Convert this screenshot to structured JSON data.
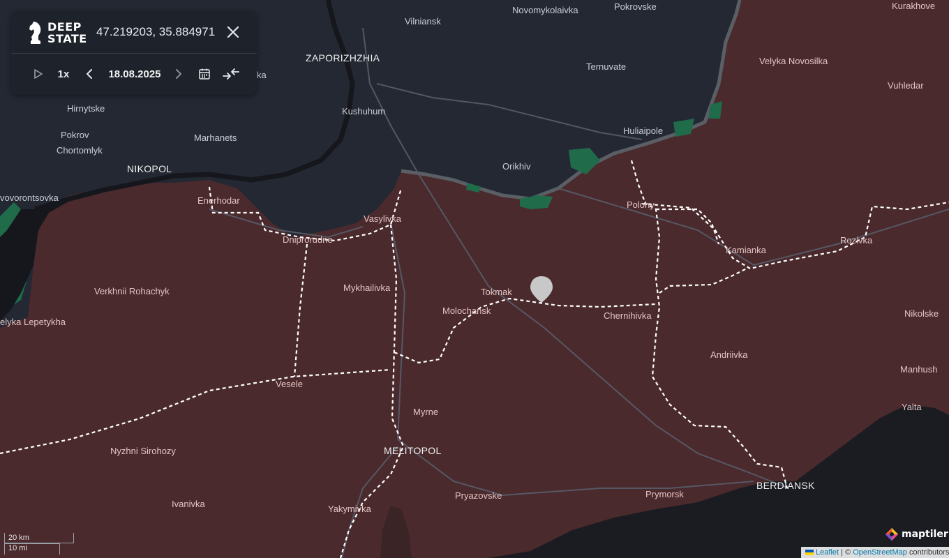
{
  "panel": {
    "logo_line1": "DEEP",
    "logo_line2": "STATE",
    "coordinates": "47.219203, 35.884971",
    "speed": "1x",
    "date": "18.08.2025",
    "icons": [
      "knight-chess-icon",
      "close-icon",
      "play-icon",
      "chevron-left-icon",
      "chevron-right-icon",
      "calendar-icon",
      "compare-arrows-icon"
    ]
  },
  "colors": {
    "free_territory": "#232833",
    "occupied_territory": "#4b2a2d",
    "liberated_territory": "#1f6b4a",
    "sea": "#1a1c21",
    "frontline_buffer": "#5a5f66",
    "railway": "#ffffff"
  },
  "labels": {
    "novomykolaivka": "Novomykolaivka",
    "pokrovske": "Pokrovske",
    "kurakhove": "Kurakhove",
    "vilniansk": "Vilniansk",
    "zaporizhzhia": "ZAPORIZHZHIA",
    "velyka_novosilka": "Velyka Novosilka",
    "ternuvate": "Ternuvate",
    "vuhledar": "Vuhledar",
    "ka": "ka",
    "hirnytske": "Hirnytske",
    "kushuhum": "Kushuhum",
    "huliaipole": "Huliaipole",
    "pokrov": "Pokrov",
    "marhanets": "Marhanets",
    "chortomlyk": "Chortomlyk",
    "orikhiv": "Orikhiv",
    "nikopol": "NIKOPOL",
    "vovorontsovka": "vovorontsovka",
    "enerhodar": "Enerhodar",
    "polohy": "Polohy",
    "vasylivka": "Vasylivka",
    "dniprorudne": "Dniprorudne",
    "kamianka": "Kamianka",
    "rozivka": "Rozivka",
    "verkhnii_rohachyk": "Verkhnii Rohachyk",
    "mykhailivka": "Mykhailivka",
    "tokmak": "Tokmak",
    "molochansk": "Molochansk",
    "chernihivka": "Chernihivka",
    "nikolske": "Nikolske",
    "velyka_lepetykha": "elyka Lepetykha",
    "andriivka": "Andriivka",
    "manhush": "Manhush",
    "vesele": "Vesele",
    "yalta": "Yalta",
    "myrne": "Myrne",
    "nyzhni_sirohozy": "Nyzhni Sirohozy",
    "melitopol": "MELITOPOL",
    "berdiansk": "BERDIANSK",
    "pryazovske": "Pryazovske",
    "prymorsk": "Prymorsk",
    "ivanivka": "Ivanivka",
    "yakymivka": "Yakymivka"
  },
  "scale": {
    "metric": "20 km",
    "imperial": "10 mi"
  },
  "attribution": {
    "leaflet": "Leaflet",
    "separator": " | © ",
    "osm": "OpenStreetMap",
    "contributors": " contributors",
    "maptiler": "maptiler"
  }
}
